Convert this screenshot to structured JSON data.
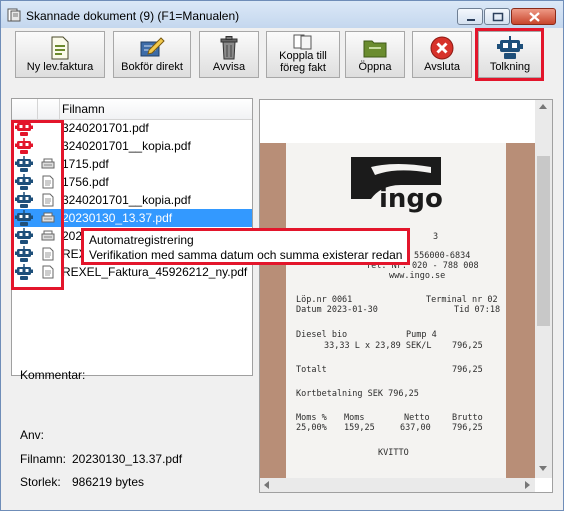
{
  "window": {
    "title": "Skannade dokument (9) (F1=Manualen)"
  },
  "toolbar": {
    "new_invoice": "Ny lev.faktura",
    "book_direct": "Bokför direkt",
    "reject_l1": "Avvisa",
    "link_l1": "Koppla till",
    "link_l2": "föreg fakt",
    "open": "Öppna",
    "quit": "Avsluta",
    "interpret": "Tolkning"
  },
  "list": {
    "header": "Filnamn",
    "rows": [
      {
        "name": "3240201701.pdf",
        "robot": "red",
        "type": ""
      },
      {
        "name": "3240201701__kopia.pdf",
        "robot": "red",
        "type": ""
      },
      {
        "name": "1715.pdf",
        "robot": "blue",
        "type": "scan"
      },
      {
        "name": "1756.pdf",
        "robot": "blue",
        "type": "doc"
      },
      {
        "name": "3240201701__kopia.pdf",
        "robot": "blue",
        "type": "doc"
      },
      {
        "name": "20230130_13.37.pdf",
        "robot": "blue",
        "type": "scan",
        "selected": true
      },
      {
        "name": "2023",
        "robot": "blue",
        "type": "scan"
      },
      {
        "name": "REXE",
        "robot": "blue",
        "type": "doc"
      },
      {
        "name": "REXEL_Faktura_45926212_ny.pdf",
        "robot": "blue",
        "type": "doc"
      }
    ]
  },
  "tooltip": {
    "title": "Automatregistrering",
    "message": "Verifikation med samma datum och summa existerar redan"
  },
  "details": {
    "comment_label": "Kommentar:",
    "user_label": "Anv:",
    "filename_label": "Filnamn:",
    "filename_value": "20230130_13.37.pdf",
    "size_label": "Storlek:",
    "size_value": "986219 bytes"
  },
  "receipt": {
    "brand": "ingo",
    "line1": "3",
    "line2": "Org. Nr: 556000-6834",
    "line3": "Tel. Nr: 020 - 788 008",
    "line4": "www.ingo.se",
    "lop": "Löp.nr 0061",
    "terminal": "Terminal nr 02",
    "datum": "Datum 2023-01-30",
    "tid": "Tid 07:18",
    "diesel": "Diesel bio",
    "pump": "Pump 4",
    "qty": "33,33 L  x  23,89 SEK/L",
    "amount": "796,25",
    "total_label": "Totalt",
    "total": "796,25",
    "card": "Kortbetalning SEK 796,25",
    "moms_pct_h": "Moms %",
    "moms_h": "Moms",
    "netto_h": "Netto",
    "brutto_h": "Brutto",
    "moms_pct": "25,00%",
    "moms": "159,25",
    "netto": "637,00",
    "brutto": "796,25",
    "kvitto": "KVITTO"
  },
  "colors": {
    "highlight": "#e3152b",
    "selection": "#3399ff",
    "robot_red": "#e3152b",
    "robot_blue": "#1e4f7a"
  }
}
